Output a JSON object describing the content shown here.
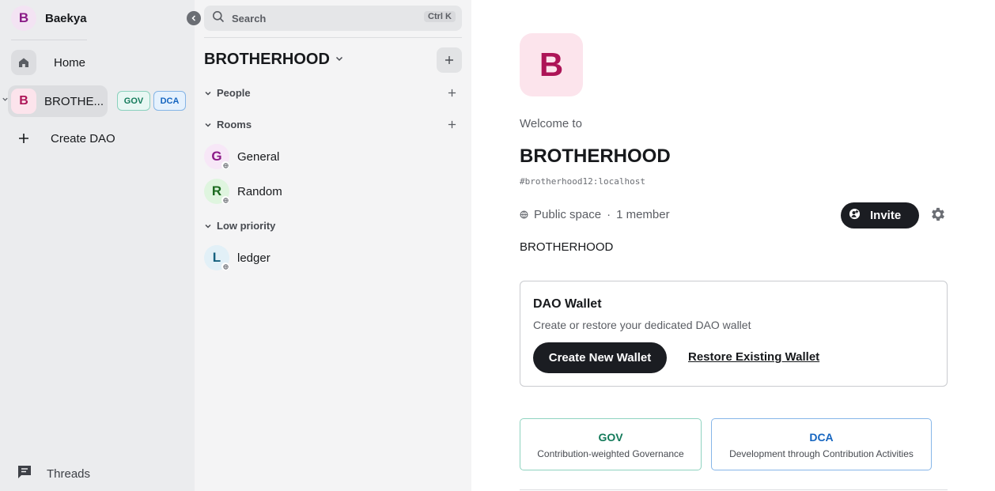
{
  "user": {
    "initial": "B",
    "name": "Baekya"
  },
  "nav": {
    "home_label": "Home",
    "space_initial": "B",
    "space_label": "BROTHE...",
    "badges": {
      "gov": "GOV",
      "dca": "DCA"
    },
    "create_dao_label": "Create DAO",
    "threads_label": "Threads"
  },
  "search": {
    "placeholder": "Search",
    "shortcut": "Ctrl K"
  },
  "room_list": {
    "space_title": "BROTHERHOOD",
    "sections": {
      "people": "People",
      "rooms": "Rooms",
      "low_priority": "Low priority"
    },
    "rooms": [
      {
        "initial": "G",
        "name": "General"
      },
      {
        "initial": "R",
        "name": "Random"
      }
    ],
    "low_priority_rooms": [
      {
        "initial": "L",
        "name": "ledger"
      }
    ]
  },
  "main": {
    "avatar_initial": "B",
    "welcome": "Welcome to",
    "title": "BROTHERHOOD",
    "alias": "#brotherhood12:localhost",
    "visibility": "Public space",
    "members": "1 member",
    "invite_label": "Invite",
    "topic": "BROTHERHOOD",
    "wallet": {
      "title": "DAO Wallet",
      "description": "Create or restore your dedicated DAO wallet",
      "create_label": "Create New Wallet",
      "restore_label": "Restore Existing Wallet"
    },
    "features": {
      "gov_title": "GOV",
      "gov_desc": "Contribution-weighted Governance",
      "dca_title": "DCA",
      "dca_desc": "Development through Contribution Activities"
    }
  },
  "colors": {
    "space_accent": "#ad1457",
    "gov_accent": "#137a5a",
    "dca_accent": "#1565c0",
    "dark_button": "#1b1d22"
  }
}
